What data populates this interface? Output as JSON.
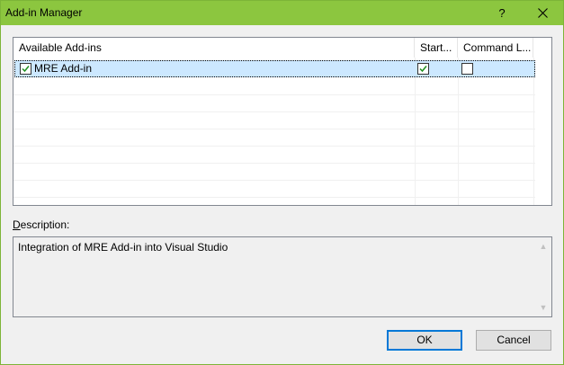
{
  "window": {
    "title": "Add-in Manager",
    "help_label": "?",
    "accent_color": "#8cc63f"
  },
  "list": {
    "columns": [
      "Available Add-ins",
      "Start...",
      "Command L..."
    ],
    "rows": [
      {
        "name": "MRE Add-in",
        "enabled": true,
        "startup": true,
        "command_line": false,
        "selected": true
      }
    ]
  },
  "description": {
    "label_underlined": "D",
    "label_rest": "escription:",
    "text": "Integration of MRE Add-in into Visual Studio"
  },
  "buttons": {
    "ok": "OK",
    "cancel": "Cancel"
  }
}
